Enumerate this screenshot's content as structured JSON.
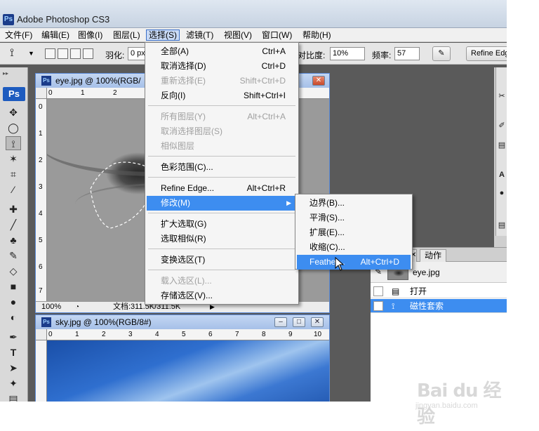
{
  "window": {
    "title": "Adobe Photoshop CS3",
    "logo": "Ps"
  },
  "menubar": {
    "items": [
      "文件(F)",
      "编辑(E)",
      "图像(I)",
      "图层(L)",
      "选择(S)",
      "滤镜(T)",
      "视图(V)",
      "窗口(W)",
      "帮助(H)"
    ],
    "active": "选择(S)"
  },
  "options": {
    "feather_label": "羽化:",
    "feather_value": "0 px",
    "contrast_label": "对比度:",
    "contrast_value": "10%",
    "frequency_label": "频率:",
    "frequency_value": "57",
    "refine_edge_label": "Refine Edge..."
  },
  "toolbox": {
    "badge": "Ps"
  },
  "select_menu": {
    "items": [
      {
        "label": "全部(A)",
        "shortcut": "Ctrl+A",
        "enabled": true
      },
      {
        "label": "取消选择(D)",
        "shortcut": "Ctrl+D",
        "enabled": true
      },
      {
        "label": "重新选择(E)",
        "shortcut": "Shift+Ctrl+D",
        "enabled": false
      },
      {
        "label": "反向(I)",
        "shortcut": "Shift+Ctrl+I",
        "enabled": true
      },
      {
        "label": "所有图层(Y)",
        "shortcut": "Alt+Ctrl+A",
        "enabled": false
      },
      {
        "label": "取消选择图层(S)",
        "shortcut": "",
        "enabled": false
      },
      {
        "label": "相似图层",
        "shortcut": "",
        "enabled": false
      },
      {
        "label": "色彩范围(C)...",
        "shortcut": "",
        "enabled": true
      },
      {
        "label": "Refine Edge...",
        "shortcut": "Alt+Ctrl+R",
        "enabled": true
      },
      {
        "label": "修改(M)",
        "shortcut": "",
        "enabled": true,
        "highlighted": true,
        "submenu": true
      },
      {
        "label": "扩大选取(G)",
        "shortcut": "",
        "enabled": true
      },
      {
        "label": "选取相似(R)",
        "shortcut": "",
        "enabled": true
      },
      {
        "label": "变换选区(T)",
        "shortcut": "",
        "enabled": true
      },
      {
        "label": "载入选区(L)...",
        "shortcut": "",
        "enabled": false
      },
      {
        "label": "存储选区(V)...",
        "shortcut": "",
        "enabled": true
      }
    ]
  },
  "modify_submenu": {
    "items": [
      {
        "label": "边界(B)...",
        "shortcut": ""
      },
      {
        "label": "平滑(S)...",
        "shortcut": ""
      },
      {
        "label": "扩展(E)...",
        "shortcut": ""
      },
      {
        "label": "收缩(C)...",
        "shortcut": ""
      },
      {
        "label": "Feather...",
        "shortcut": "Alt+Ctrl+D",
        "highlighted": true
      }
    ]
  },
  "doc_eye": {
    "title": "eye.jpg @ 100%(RGB/",
    "ruler_h": [
      "0",
      "1",
      "2"
    ],
    "ruler_v": [
      "0",
      "1",
      "2",
      "3",
      "4",
      "5",
      "6",
      "7"
    ],
    "zoom": "100%",
    "doc_info": "文档:311.5K/311.5K"
  },
  "doc_sky": {
    "title": "sky.jpg @ 100%(RGB/8#)",
    "ruler_h": [
      "0",
      "1",
      "2",
      "3",
      "4",
      "5",
      "6",
      "7",
      "8",
      "9",
      "10"
    ]
  },
  "history_panel": {
    "tab_label": "动作",
    "snapshot_label": "eye.jpg",
    "rows": [
      {
        "label": "打开",
        "selected": false
      },
      {
        "label": "磁性套索",
        "selected": true
      }
    ]
  },
  "watermark": {
    "text": "Bai du 经验",
    "url": "jingyan.baidu.com"
  },
  "colors": {
    "menu_highlight": "#3d8df0",
    "app_bg": "#5a5a5a"
  }
}
